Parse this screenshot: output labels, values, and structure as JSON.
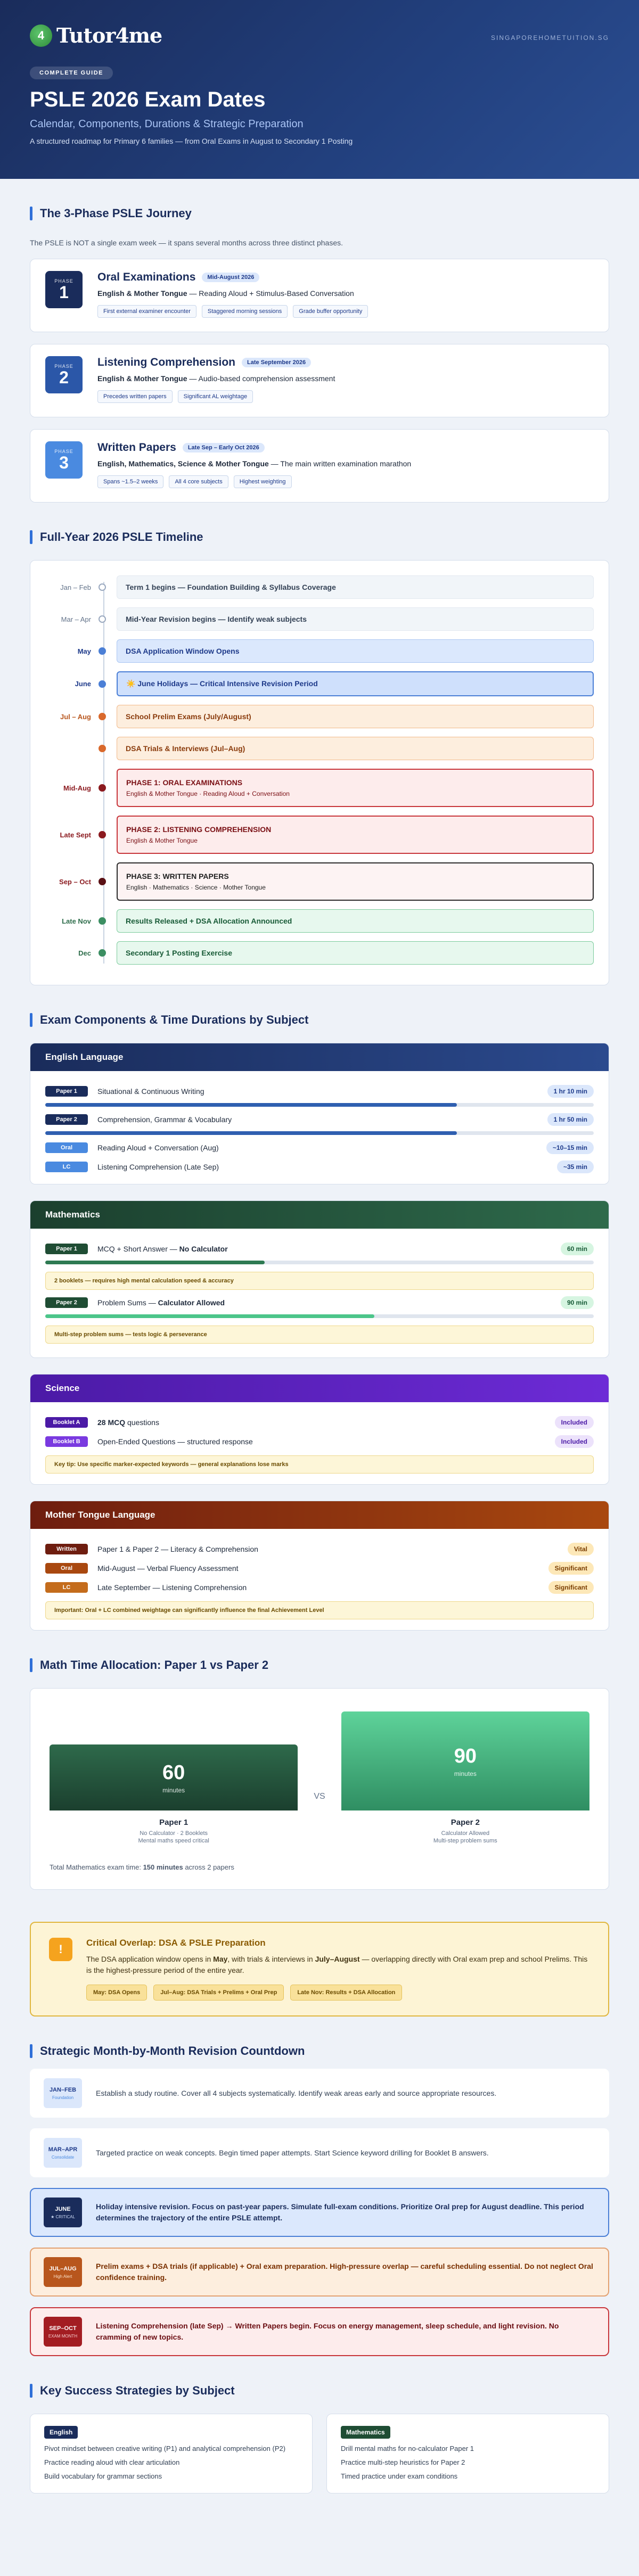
{
  "hero": {
    "logo_icon": "4",
    "logo_text": "Tutor4me",
    "site": "SINGAPOREHOMETUITION.SG",
    "pill": "COMPLETE GUIDE",
    "title": "PSLE 2026 Exam Dates",
    "subtitle": "Calendar, Components, Durations & Strategic Preparation",
    "description": "A structured roadmap for Primary 6 families — from Oral Exams in August to Secondary 1 Posting"
  },
  "phases": {
    "title": "The 3-Phase PSLE Journey",
    "intro": "The PSLE is NOT a single exam week — it spans several months across three distinct phases.",
    "items": [
      {
        "label": "PHASE",
        "num": "1",
        "title": "Oral Examinations",
        "tag": "Mid-August 2026",
        "line_bold": "English & Mother Tongue",
        "line_rest": " — Reading Aloud + Stimulus-Based Conversation",
        "chips": [
          "First external examiner encounter",
          "Staggered morning sessions",
          "Grade buffer opportunity"
        ],
        "color": "#1a2c5b"
      },
      {
        "label": "PHASE",
        "num": "2",
        "title": "Listening Comprehension",
        "tag": "Late September 2026",
        "line_bold": "English & Mother Tongue",
        "line_rest": " — Audio-based comprehension assessment",
        "chips": [
          "Precedes written papers",
          "Significant AL weightage"
        ],
        "color": "#2b57a8"
      },
      {
        "label": "PHASE",
        "num": "3",
        "title": "Written Papers",
        "tag": "Late Sep – Early Oct 2026",
        "line_bold": "English, Mathematics, Science & Mother Tongue",
        "line_rest": " — The main written examination marathon",
        "chips": [
          "Spans ~1.5–2 weeks",
          "All 4 core subjects",
          "Highest weighting"
        ],
        "color": "#4a8ae0"
      }
    ]
  },
  "timeline": {
    "title": "Full-Year 2026 PSLE Timeline",
    "rows": [
      {
        "date": "Jan – Feb",
        "text": "Term 1 begins — Foundation Building & Syllabus Coverage",
        "small": "",
        "style": "grey"
      },
      {
        "date": "Mar – Apr",
        "text": "Mid-Year Revision begins — Identify weak subjects",
        "small": "",
        "style": "grey"
      },
      {
        "date": "May",
        "text": "DSA Application Window Opens",
        "small": "",
        "style": "blue"
      },
      {
        "date": "June",
        "text": "☀️ June Holidays — Critical Intensive Revision Period",
        "small": "",
        "style": "bluestrong"
      },
      {
        "date": "Jul – Aug",
        "text": "School Prelim Exams (July/August)",
        "small": "",
        "style": "orange"
      },
      {
        "date": "",
        "text": "DSA Trials & Interviews (Jul–Aug)",
        "small": "",
        "style": "orange"
      },
      {
        "date": "Mid-Aug",
        "text": "PHASE 1: ORAL EXAMINATIONS",
        "small": "English & Mother Tongue · Reading Aloud + Conversation",
        "style": "red"
      },
      {
        "date": "Late Sept",
        "text": "PHASE 2: LISTENING COMPREHENSION",
        "small": "English & Mother Tongue",
        "style": "red"
      },
      {
        "date": "Sep – Oct",
        "text": "PHASE 3: WRITTEN PAPERS",
        "small": "English · Mathematics · Science · Mother Tongue",
        "style": "dark"
      },
      {
        "date": "Late Nov",
        "text": "Results Released + DSA Allocation Announced",
        "small": "",
        "style": "green"
      },
      {
        "date": "Dec",
        "text": "Secondary 1 Posting Exercise",
        "small": "",
        "style": "green"
      }
    ]
  },
  "components": {
    "title": "Exam Components & Time Durations by Subject",
    "english": {
      "head": "English Language",
      "rows": [
        {
          "badge": "Paper 1",
          "name": "Situational & Continuous Writing",
          "dur": "1 hr 10 min",
          "pct": 0.75
        },
        {
          "badge": "Paper 2",
          "name": "Comprehension, Grammar & Vocabulary",
          "dur": "1 hr 50 min",
          "pct": 0.75
        },
        {
          "badge": "Oral",
          "name": "Reading Aloud + Conversation (Aug)",
          "dur": "~10–15 min",
          "pct": 0
        },
        {
          "badge": "LC",
          "name": "Listening Comprehension (Late Sep)",
          "dur": "~35 min",
          "pct": 0
        }
      ]
    },
    "math": {
      "head": "Mathematics",
      "rows": [
        {
          "badge": "Paper 1",
          "name_a": "MCQ + Short Answer — ",
          "name_b": "No Calculator",
          "dur": "60 min",
          "pct": 0.4,
          "note": "2 booklets — requires high mental calculation speed & accuracy"
        },
        {
          "badge": "Paper 2",
          "name_a": "Problem Sums — ",
          "name_b": "Calculator Allowed",
          "dur": "90 min",
          "pct": 0.6,
          "note": "Multi-step problem sums — tests logic & perseverance"
        }
      ]
    },
    "science": {
      "head": "Science",
      "rows": [
        {
          "badge": "Booklet A",
          "name_a": "28 MCQ",
          "name_b": " questions",
          "dur": "Included"
        },
        {
          "badge": "Booklet B",
          "name_a": "",
          "name_b": "Open-Ended Questions — structured response",
          "dur": "Included"
        }
      ],
      "note": "Key tip: Use specific marker-expected keywords — general explanations lose marks"
    },
    "mt": {
      "head": "Mother Tongue Language",
      "rows": [
        {
          "badge": "Written",
          "name": "Paper 1 & Paper 2 — Literacy & Comprehension",
          "dur": "Vital"
        },
        {
          "badge": "Oral",
          "name": "Mid-August — Verbal Fluency Assessment",
          "dur": "Significant"
        },
        {
          "badge": "LC",
          "name": "Late September — Listening Comprehension",
          "dur": "Significant"
        }
      ],
      "note": "Important: Oral + LC combined weightage can significantly influence the final Achievement Level"
    }
  },
  "alloc": {
    "title": "Math Time Allocation: Paper 1 vs Paper 2",
    "p1": {
      "minutes": 60,
      "unit": "minutes",
      "name": "Paper 1",
      "desc1": "No Calculator · 2 Booklets",
      "desc2": "Mental maths speed critical"
    },
    "vs": "VS",
    "p2": {
      "minutes": 90,
      "unit": "minutes",
      "name": "Paper 2",
      "desc1": "Calculator Allowed",
      "desc2": "Multi-step problem sums"
    },
    "total_a": "Total Mathematics exam time: ",
    "total_b": "150 minutes",
    "total_c": " across 2 papers"
  },
  "overlap": {
    "icon": "!",
    "title": "Critical Overlap: DSA & PSLE Preparation",
    "text_a": "The DSA application window opens in ",
    "text_b": "May",
    "text_c": ", with trials & interviews in ",
    "text_d": "July–August",
    "text_e": " — overlapping directly with Oral exam prep and school Prelims. This is the highest-pressure period of the entire year.",
    "chips": [
      "May: DSA Opens",
      "Jul–Aug: DSA Trials + Prelims + Oral Prep",
      "Late Nov: Results + DSA Allocation"
    ]
  },
  "countdown": {
    "title": "Strategic Month-by-Month Revision Countdown",
    "rows": [
      {
        "m": "JAN–FEB",
        "s": "Foundation",
        "text": "Establish a study routine. Cover all 4 subjects systematically. Identify weak areas early and source appropriate resources.",
        "style": "plain"
      },
      {
        "m": "MAR–APR",
        "s": "Consolidate",
        "text": "Targeted practice on weak concepts. Begin timed paper attempts. Start Science keyword drilling for Booklet B answers.",
        "style": "plain"
      },
      {
        "m": "JUNE",
        "s": "★ CRITICAL",
        "text": "Holiday intensive revision. Focus on past-year papers. Simulate full-exam conditions. Prioritize Oral prep for August deadline. This period determines the trajectory of the entire PSLE attempt.",
        "style": "blue"
      },
      {
        "m": "JUL–AUG",
        "s": "High Alert",
        "text": "Prelim exams + DSA trials (if applicable) + Oral exam preparation. High-pressure overlap — careful scheduling essential. Do not neglect Oral confidence training.",
        "style": "orange"
      },
      {
        "m": "SEP–OCT",
        "s": "EXAM MONTH",
        "text": "Listening Comprehension (late Sep) → Written Papers begin. Focus on energy management, sleep schedule, and light revision. No cramming of new topics.",
        "style": "red"
      }
    ]
  },
  "strategies": {
    "title": "Key Success Strategies by Subject",
    "cards": [
      {
        "tag": "English",
        "color": "#1a2c5b",
        "items": [
          "Pivot mindset between creative writing (P1) and analytical comprehension (P2)",
          "Practice reading aloud with clear articulation",
          "Build vocabulary for grammar sections"
        ]
      },
      {
        "tag": "Mathematics",
        "color": "#1f4d34",
        "items": [
          "Drill mental maths for no-calculator Paper 1",
          "Practice multi-step heuristics for Paper 2",
          "Timed practice under exam conditions"
        ]
      }
    ]
  }
}
